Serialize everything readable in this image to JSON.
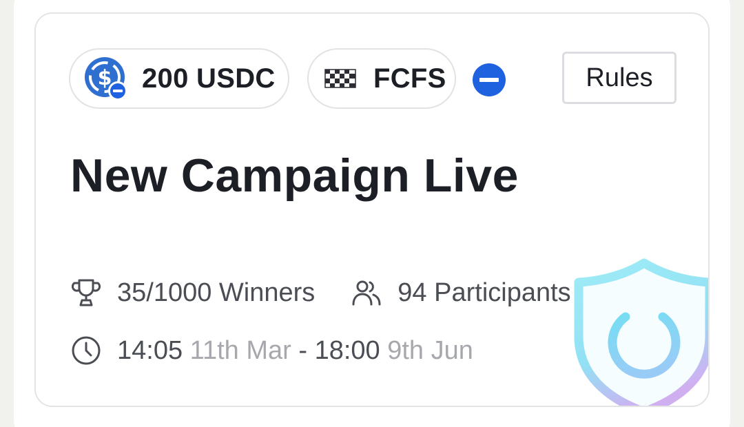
{
  "campaign": {
    "reward": {
      "label": "200 USDC",
      "icon": "usdc-coin-icon"
    },
    "type": {
      "label": "FCFS",
      "icon": "checkered-flag-icon"
    },
    "network_badge_icon": "blue-minus-badge-icon",
    "rules_label": "Rules",
    "title": "New Campaign Live",
    "winners": {
      "text": "35/1000 Winners",
      "icon": "trophy-icon"
    },
    "participants": {
      "text": "94 Participants",
      "icon": "people-icon"
    },
    "schedule": {
      "icon": "clock-icon",
      "start_time": "14:05",
      "start_date": "11th Mar",
      "separator": "-",
      "end_time": "18:00",
      "end_date": "9th Jun"
    }
  },
  "overlay": {
    "icon": "shield-power-icon"
  },
  "colors": {
    "accent_blue": "#1f62e0",
    "coin_blue": "#2f6fd0",
    "text_dark": "#1c1f26",
    "text_muted": "#a6a8ae",
    "shield_cyan": "#7fe3f4"
  }
}
